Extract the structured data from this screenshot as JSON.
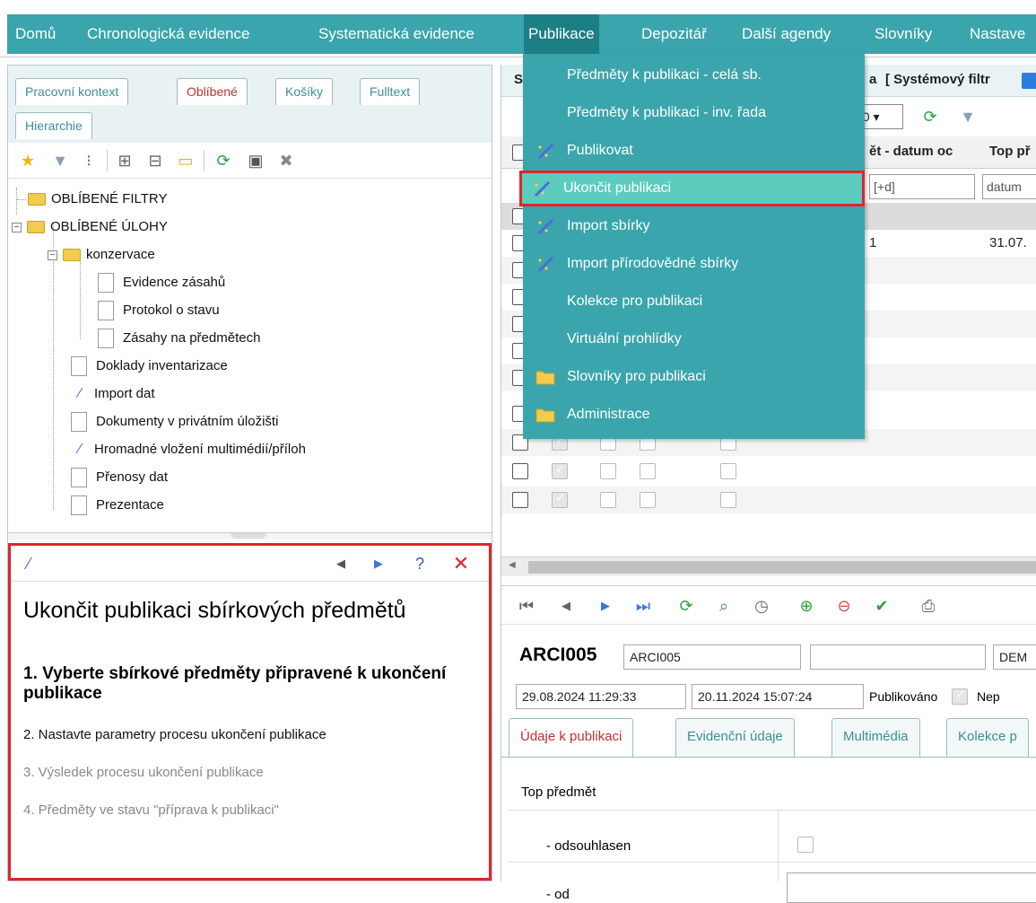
{
  "menubar": {
    "items": [
      "Domů",
      "Chronologická evidence",
      "Systematická evidence",
      "Publikace",
      "Depozitář",
      "Další agendy",
      "Slovníky",
      "Nastave"
    ],
    "active_index": 3
  },
  "left_tabs": [
    "Pracovní kontext",
    "Oblíbené",
    "Košíky",
    "Fulltext",
    "Hierarchie"
  ],
  "left_active_tab": "Oblíbené",
  "tree": {
    "favorite_filters": "OBLÍBENÉ FILTRY",
    "favorite_tasks": "OBLÍBENÉ ÚLOHY",
    "conservation": "konzervace",
    "conservation_children": [
      "Evidence zásahů",
      "Protokol o stavu",
      "Zásahy na předmětech"
    ],
    "items": [
      "Doklady inventarizace",
      "Import dat",
      "Dokumenty v privátním úložišti",
      "Hromadné vložení multimédií/příloh",
      "Přenosy dat",
      "Prezentace"
    ]
  },
  "help": {
    "title": "Ukončit publikaci sbírkových předmětů",
    "step1": "1. Vyberte sbírkové předměty připravené k ukončení publikace",
    "step2": "2. Nastavte parametry procesu ukončení publikace",
    "step3": "3. Výsledek procesu ukončení publikace",
    "step4": "4. Předměty ve stavu \"příprava k publikaci\""
  },
  "right": {
    "header_prefix": "S",
    "header_suffix": "a",
    "system_filter": "[ Systémový filtr",
    "page_size": "00",
    "col_date_from": "ět - datum oc",
    "col_top": "Top př",
    "filter_date": "[+d]",
    "filter_top": "datum",
    "row_value_a": "1",
    "row_value_b": "31.07."
  },
  "record": {
    "id": "ARCI005",
    "id_field": "ARCI005",
    "org_field": "DEM",
    "created": "29.08.2024 11:29:33",
    "modified": "20.11.2024 15:07:24",
    "published_label": "Publikováno",
    "nep_label": "Nep"
  },
  "detail_tabs": [
    "Údaje k publikaci",
    "Evidenční údaje",
    "Multimédia",
    "Kolekce p"
  ],
  "form": {
    "section": "Top předmět",
    "approved": "- odsouhlasen",
    "from": "- od"
  },
  "dropdown": {
    "items": [
      {
        "label": "Předměty k publikaci - celá sb.",
        "icon": "none"
      },
      {
        "label": "Předměty k publikaci - inv. řada",
        "icon": "none"
      },
      {
        "label": "Publikovat",
        "icon": "wand-icon"
      },
      {
        "label": "Ukončit publikaci",
        "icon": "wand-icon"
      },
      {
        "label": "Import sbírky",
        "icon": "wand-icon"
      },
      {
        "label": "Import přírodovědné sbírky",
        "icon": "wand-icon"
      },
      {
        "label": "Kolekce pro publikaci",
        "icon": "none"
      },
      {
        "label": "Virtuální prohlídky",
        "icon": "none"
      },
      {
        "label": "Slovníky pro publikaci",
        "icon": "folder-icon"
      },
      {
        "label": "Administrace",
        "icon": "folder-icon"
      }
    ],
    "selected_index": 3
  },
  "colors": {
    "accent": "#3aa5ac",
    "accent_dark": "#1d7f86",
    "highlight": "#e0252b"
  }
}
